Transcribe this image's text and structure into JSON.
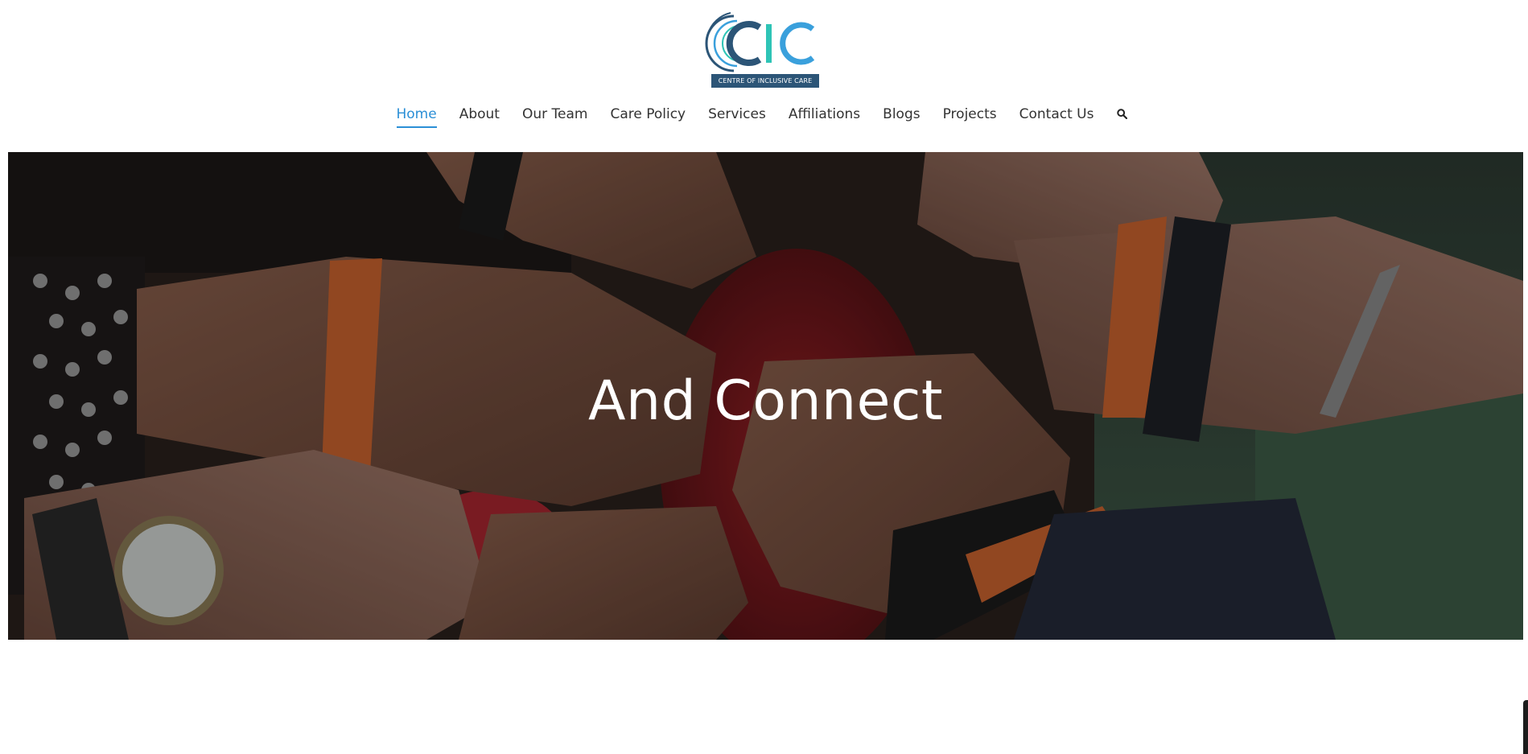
{
  "brand": {
    "logo_text": "CIC",
    "tagline": "CENTRE OF INCLUSIVE CARE",
    "colors": {
      "dark_blue": "#2c5577",
      "teal": "#2ec4b6",
      "light_blue": "#3aa0dc"
    }
  },
  "nav": {
    "items": [
      {
        "label": "Home",
        "active": true
      },
      {
        "label": "About"
      },
      {
        "label": "Our Team"
      },
      {
        "label": "Care Policy"
      },
      {
        "label": "Services"
      },
      {
        "label": "Affiliations"
      },
      {
        "label": "Blogs"
      },
      {
        "label": "Projects"
      },
      {
        "label": "Contact Us"
      }
    ],
    "search_icon": "search-icon",
    "active_color": "#2b8fd6",
    "text_color": "#333333"
  },
  "hero": {
    "title": "And Connect",
    "image": "hands-with-wristbands-photo"
  }
}
